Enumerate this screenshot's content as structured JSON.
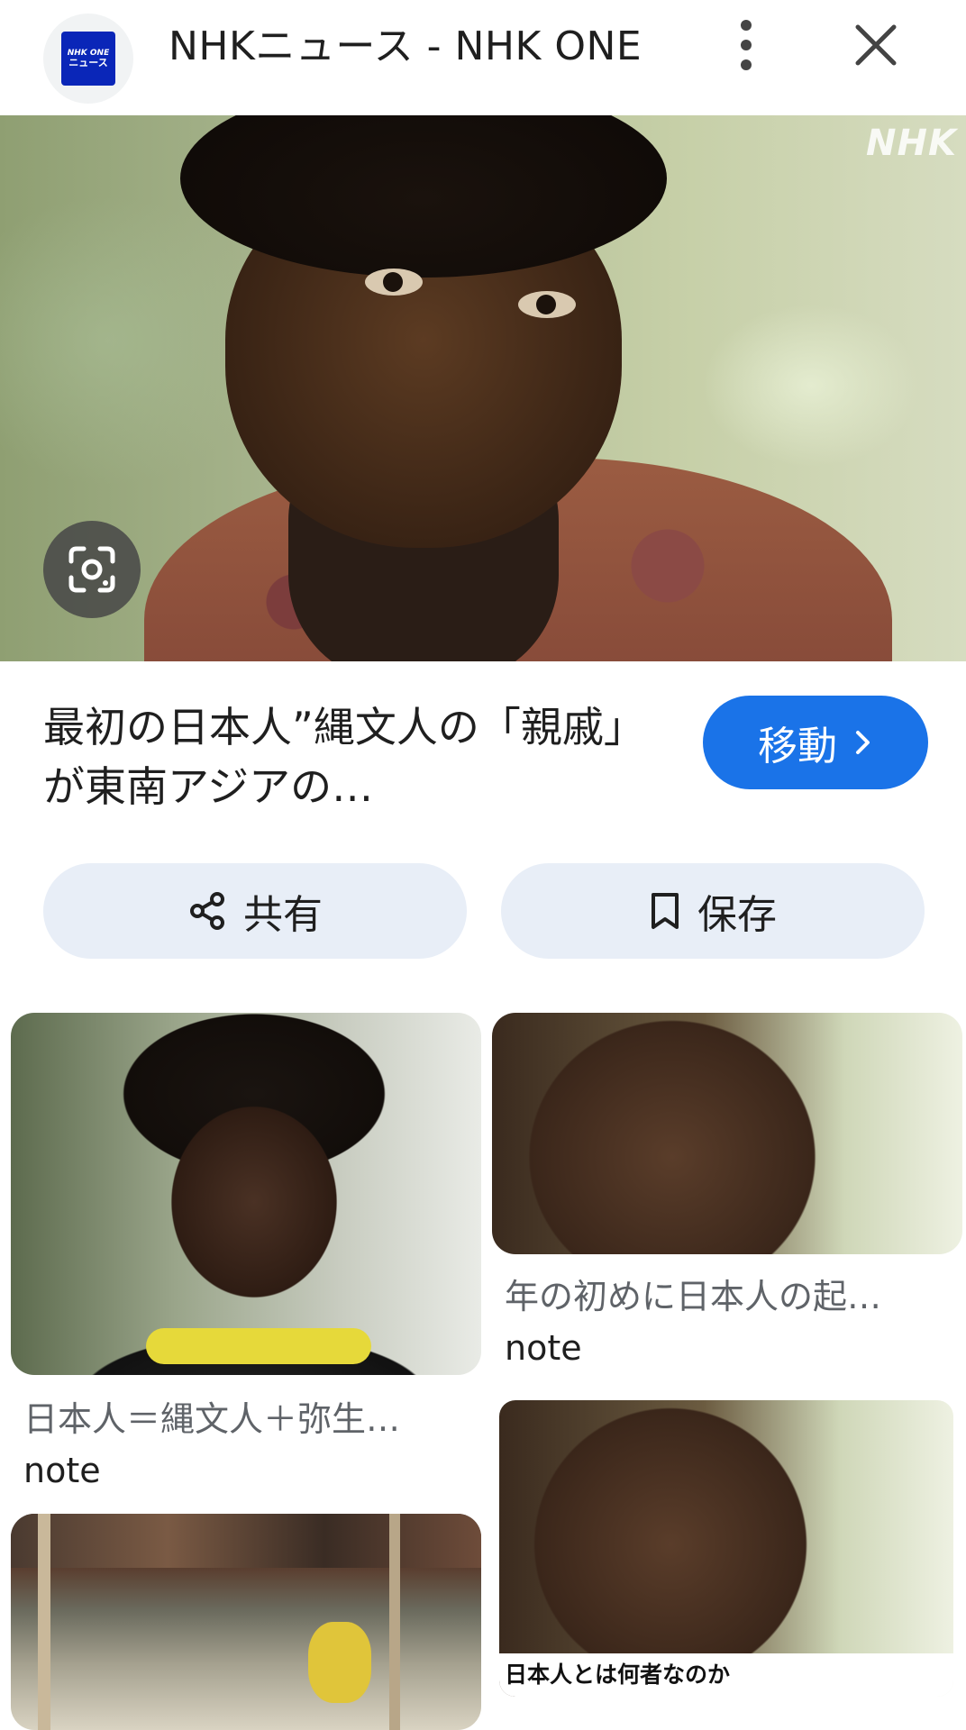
{
  "header": {
    "logo_text_line1": "NHK ONE",
    "logo_text_line2": "ニュース",
    "title": "NHKニュース - NHK ONE",
    "more_icon": "more-vert-icon",
    "close_icon": "close-icon"
  },
  "hero": {
    "watermark": "NHK",
    "lens_icon": "lens-search-icon"
  },
  "result": {
    "headline": "最初の日本人”縄文人の「親戚」が東南アジアの…",
    "go_label": "移動",
    "go_icon": "chevron-right-icon"
  },
  "actions": {
    "share_label": "共有",
    "save_label": "保存"
  },
  "related": [
    {
      "title": "日本人＝縄文人＋弥生…",
      "source": "note"
    },
    {
      "title": "年の初めに日本人の起…",
      "source": "note"
    },
    {
      "title": "",
      "source": ""
    },
    {
      "title": "",
      "source": "",
      "caption": "日本人とは何者なのか"
    }
  ],
  "colors": {
    "accent": "#1a73e8",
    "pill_bg": "#e8eef7",
    "logo_bg": "#0a26b8"
  }
}
